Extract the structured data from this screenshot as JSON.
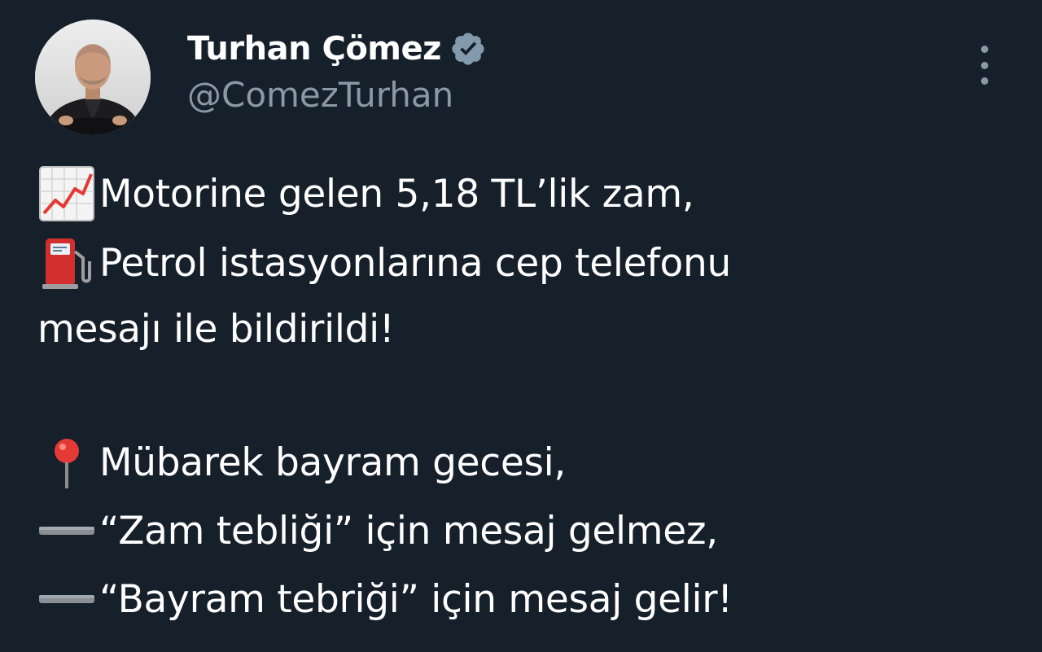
{
  "tweet": {
    "author": {
      "display_name": "Turhan Çömez",
      "handle": "@ComezTurhan",
      "verified": true
    },
    "more_icon": "more-vertical-icon",
    "lines": [
      {
        "emoji": "chart-increasing-icon",
        "text": "Motorine gelen 5,18 TL’lik zam,"
      },
      {
        "emoji": "fuel-pump-icon",
        "text": "Petrol istasyonlarına cep telefonu"
      },
      {
        "emoji": "",
        "text": "mesajı ile bildirildi!"
      },
      {
        "emoji": "round-pushpin-icon",
        "text": " Mübarek bayram gecesi,"
      },
      {
        "emoji": "minus-bar-icon",
        "text": "“Zam tebliği” için mesaj gelmez,"
      },
      {
        "emoji": "minus-bar-icon",
        "text": "“Bayram tebriği” için mesaj gelir!"
      }
    ]
  },
  "colors": {
    "background": "#15202b",
    "text": "#ffffff",
    "secondary": "#8b98a5",
    "verified_badge": "#829aab"
  }
}
